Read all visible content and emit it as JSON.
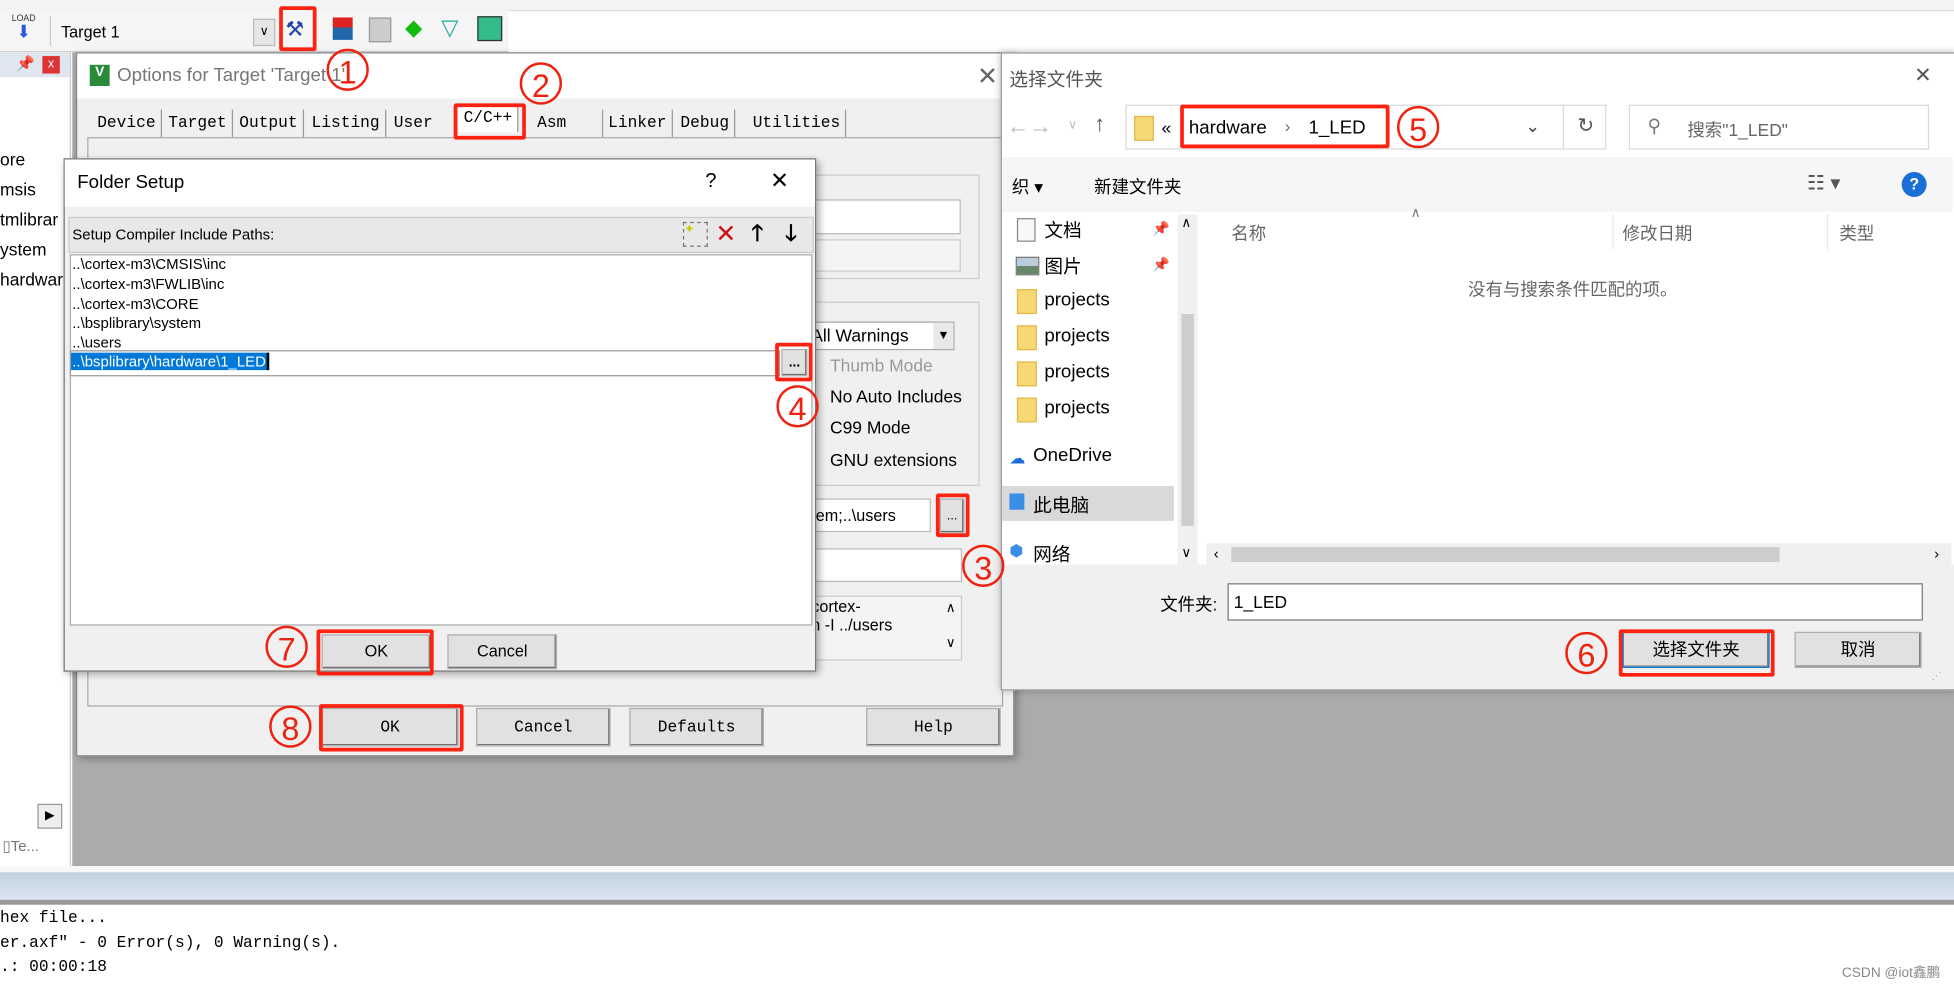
{
  "toolbar": {
    "target": "Target 1",
    "load_label": "LOAD",
    "icons": [
      "load-icon",
      "options-for-target-icon",
      "manage-project-icon",
      "batch-build-icon",
      "select-packs-icon",
      "pack-installer-icon",
      "rte-icon"
    ]
  },
  "project_panel": {
    "items": [
      "ore",
      "msis",
      "tmlibrar",
      "ystem",
      "hardware"
    ],
    "tab": "Te..."
  },
  "options": {
    "title": "Options for Target 'Target 1'",
    "tabs": [
      "Device",
      "Target",
      "Output",
      "Listing",
      "User",
      "C/C++",
      "Asm",
      "Linker",
      "Debug",
      "Utilities"
    ],
    "active_tab": "C/C++",
    "warnings": "All Warnings",
    "checkboxes": [
      {
        "label": "Thumb Mode",
        "disabled": true
      },
      {
        "label": "No Auto Includes"
      },
      {
        "label": "C99 Mode"
      },
      {
        "label": "GNU extensions"
      }
    ],
    "include_paths_value": "tem;..\\users",
    "browse": "...",
    "misc_lines": [
      "cortex-",
      "n -I ../users"
    ],
    "buttons": {
      "ok": "OK",
      "cancel": "Cancel",
      "defaults": "Defaults",
      "help": "Help"
    }
  },
  "folder_setup": {
    "title": "Folder Setup",
    "help": "?",
    "header": "Setup Compiler Include Paths:",
    "paths": [
      "..\\cortex-m3\\CMSIS\\inc",
      "..\\cortex-m3\\FWLIB\\inc",
      "..\\cortex-m3\\CORE",
      "..\\bsplibrary\\system",
      "..\\users"
    ],
    "editing": "..\\bsplibrary\\hardware\\1_LED",
    "browse": "...",
    "ok": "OK",
    "cancel": "Cancel"
  },
  "file_dialog": {
    "title": "选择文件夹",
    "breadcrumb_prefix": "«",
    "breadcrumb": [
      "hardware",
      "1_LED"
    ],
    "search_placeholder": "搜索\"1_LED\"",
    "organize": "织 ▾",
    "new_folder": "新建文件夹",
    "nav": [
      "文档",
      "图片",
      "projects",
      "projects",
      "projects",
      "projects",
      "OneDrive",
      "此电脑",
      "网络"
    ],
    "selected_nav": "此电脑",
    "columns": [
      "名称",
      "修改日期",
      "类型"
    ],
    "empty_message": "没有与搜索条件匹配的项。",
    "folder_label": "文件夹:",
    "folder_value": "1_LED",
    "select_button": "选择文件夹",
    "cancel_button": "取消"
  },
  "output": {
    "lines": [
      "hex file...",
      "er.axf\" - 0 Error(s), 0 Warning(s).",
      ".:  00:00:18"
    ]
  },
  "watermark": "CSDN @iot鑫鹏",
  "annotations": [
    "1",
    "2",
    "3",
    "4",
    "5",
    "6",
    "7",
    "8"
  ],
  "colors": {
    "annotation": "#ee2211",
    "selection": "#0078d7",
    "workspace": "#ababab"
  }
}
